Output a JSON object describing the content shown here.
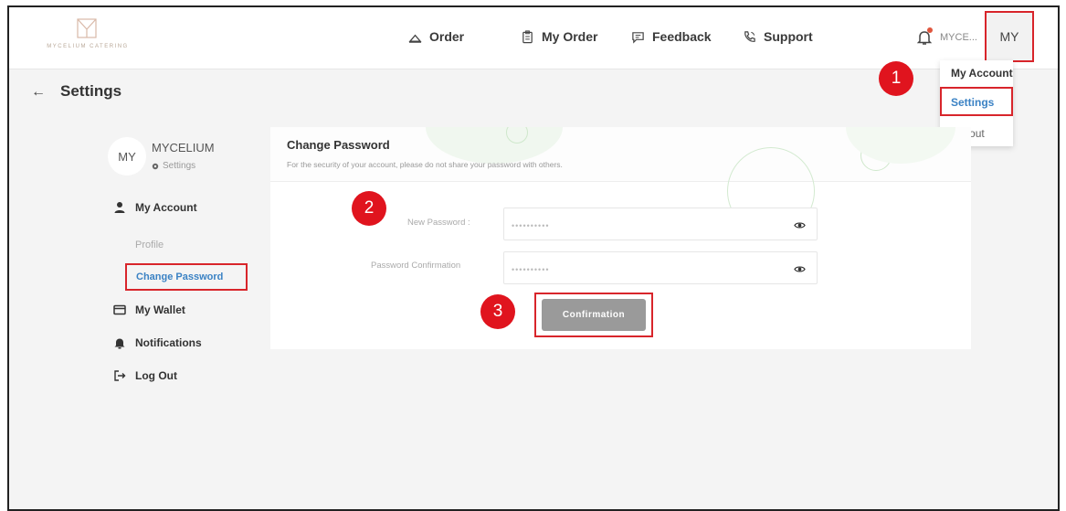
{
  "brand": {
    "logo_text": "MYCELIUM CATERING"
  },
  "nav": {
    "items": [
      {
        "label": "Order",
        "icon": "home-icon"
      },
      {
        "label": "My Order",
        "icon": "clipboard-icon"
      },
      {
        "label": "Feedback",
        "icon": "chat-icon"
      },
      {
        "label": "Support",
        "icon": "phone-icon"
      }
    ],
    "username": "MYCE...",
    "avatar": "MY"
  },
  "dropdown": {
    "items": [
      "My Account",
      "Settings",
      "Logout"
    ]
  },
  "header": {
    "title": "Settings"
  },
  "sidebar": {
    "avatar": "MY",
    "name": "MYCELIUM",
    "sub": "Settings",
    "items": [
      {
        "label": "My Account",
        "icon": "user-icon"
      },
      {
        "label": "My Wallet",
        "icon": "card-icon"
      },
      {
        "label": "Notifications",
        "icon": "bell-icon"
      },
      {
        "label": "Log Out",
        "icon": "logout-icon"
      }
    ],
    "sub_items": [
      "Profile",
      "Change Password"
    ]
  },
  "card": {
    "title": "Change Password",
    "subtitle": "For the security of your account, please do not share your password with others.",
    "fields": [
      {
        "label": "New Password :",
        "value": "••••••••••"
      },
      {
        "label": "Password Confirmation",
        "value": "••••••••••"
      }
    ],
    "button": "Confirmation"
  },
  "markers": [
    "1",
    "2",
    "3"
  ],
  "colors": {
    "highlight": "#d8252b",
    "marker": "#e0141e",
    "link": "#3b82c4",
    "button": "#9a9a9a"
  }
}
